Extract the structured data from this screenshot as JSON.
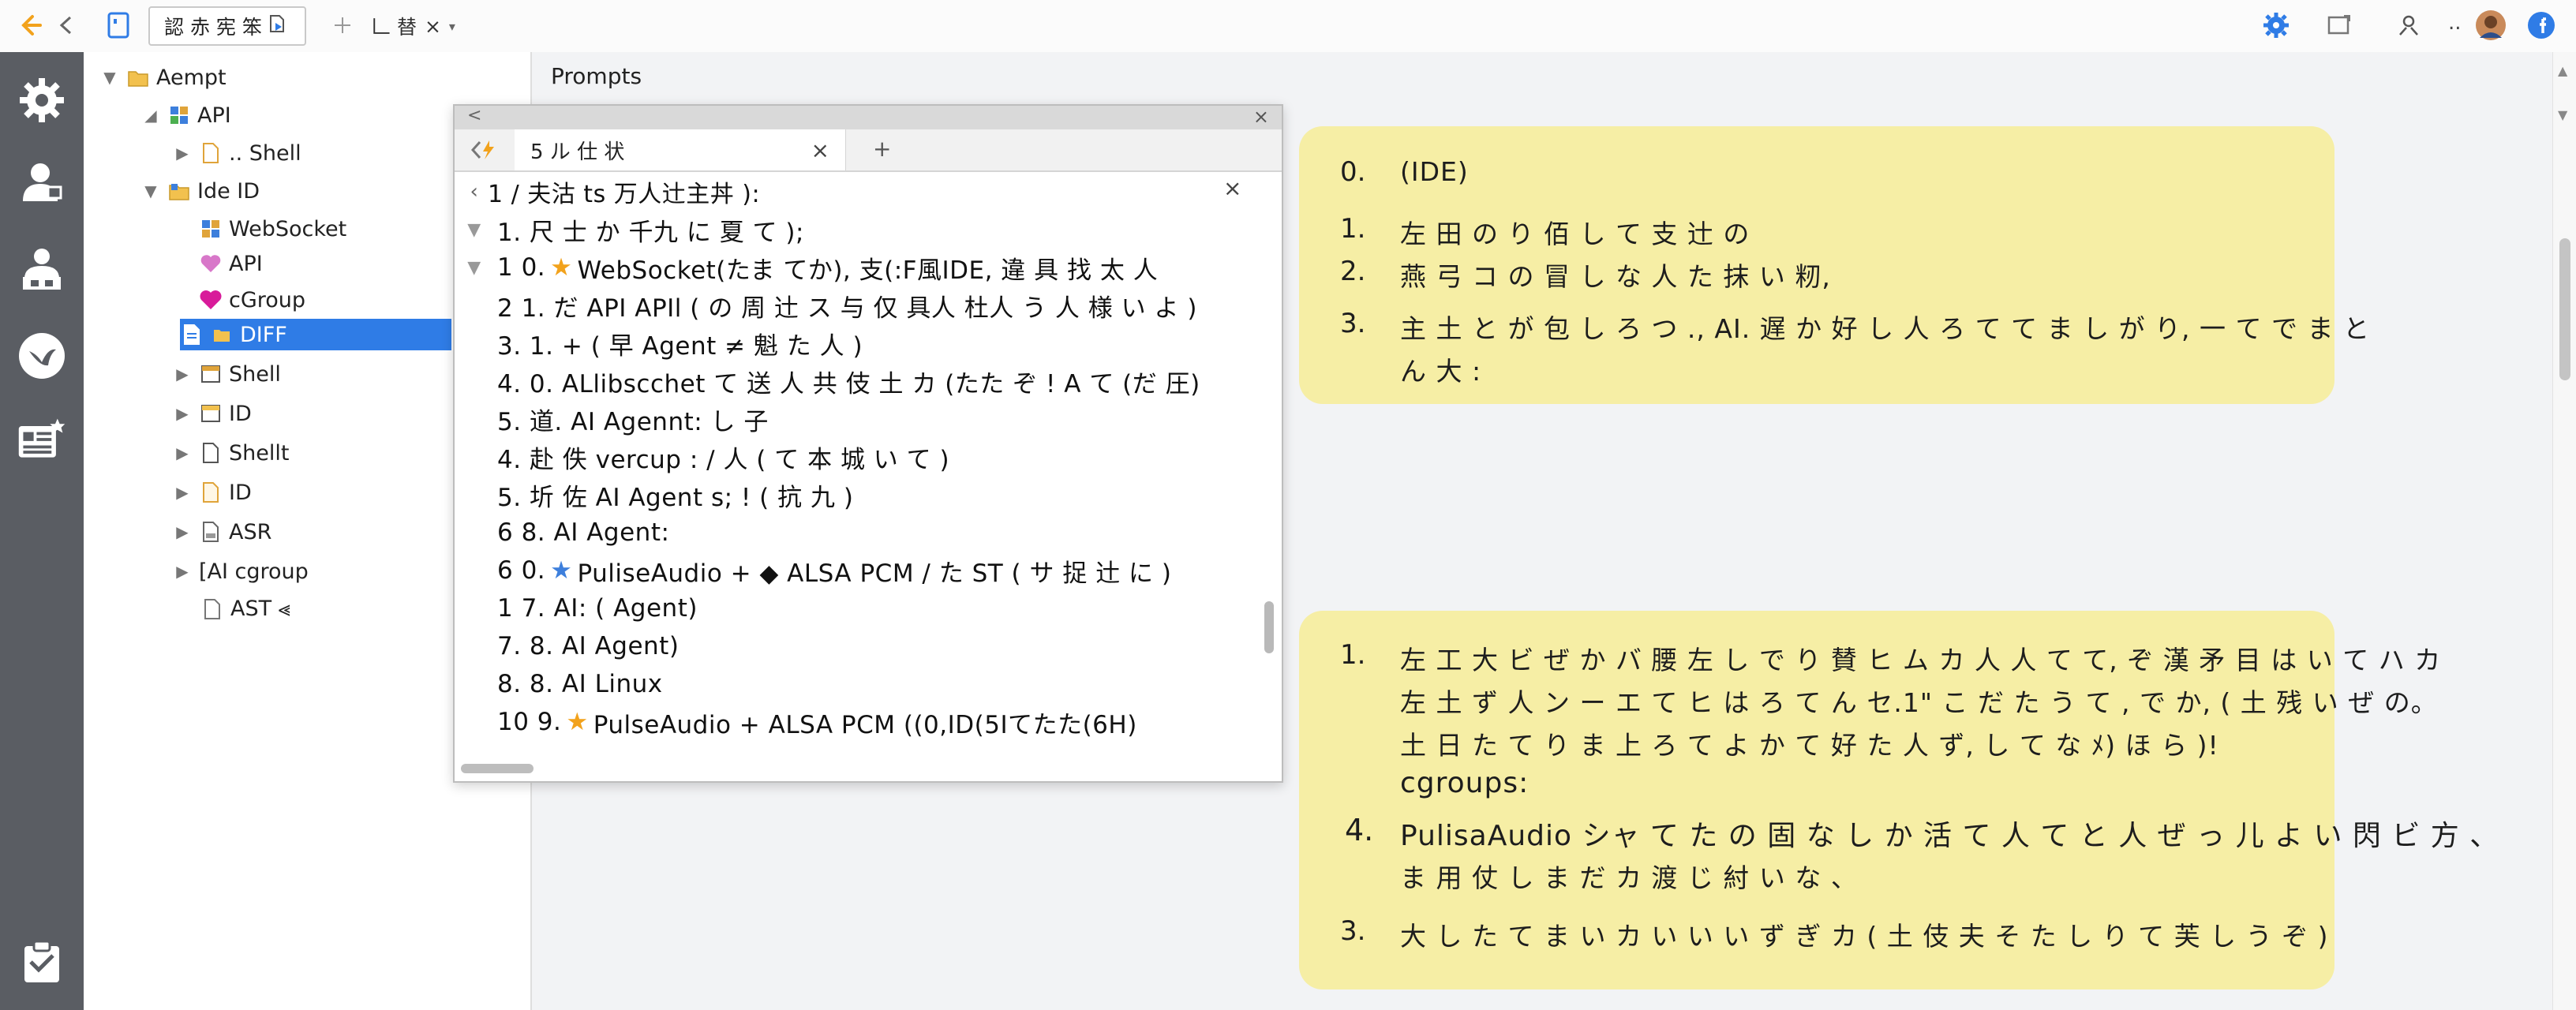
{
  "colors": {
    "accent": "#2f7ce6",
    "activity_bar": "#5a5d63",
    "card_bg": "#f6eea5",
    "star": "#f2a21c",
    "back_arrow": "#f2a21c"
  },
  "toolbar": {
    "tab_active_label": "認 赤 宪 笨",
    "tab_second_label": "𠃊 替",
    "tab_second_close": "×",
    "icons": [
      "back-arrow-icon",
      "forward-chevron-icon",
      "document-icon",
      "search-file-icon",
      "pin-icon",
      "dropdown-icon",
      "gear-icon",
      "window-icon",
      "person-icon",
      "avatar",
      "facebook-icon"
    ],
    "more_label": ".."
  },
  "activity_bar": {
    "icons": [
      "settings-gear-icon",
      "user-icon",
      "user-group-icon",
      "bird-icon",
      "news-icon",
      "clipboard-icon"
    ]
  },
  "tree": {
    "items": [
      {
        "label": "Aempt",
        "depth": 0,
        "twisty": "▼",
        "icon": "folder-icon"
      },
      {
        "label": "API",
        "depth": 1,
        "twisty": "◢",
        "icon": "grid-icon"
      },
      {
        "label": ".. Shell",
        "depth": 2,
        "twisty": "▶",
        "icon": "file-icon"
      },
      {
        "label": "Ide ID",
        "depth": 1,
        "twisty": "▼",
        "icon": "folder-grid-icon"
      },
      {
        "label": "WebSocket",
        "depth": 2,
        "twisty": "",
        "icon": "grid-icon"
      },
      {
        "label": "API",
        "depth": 2,
        "twisty": "",
        "icon": "heart-icon"
      },
      {
        "label": "cGroup",
        "depth": 2,
        "twisty": "",
        "icon": "heart-icon"
      },
      {
        "label": "DIFF",
        "depth": 2,
        "twisty": "",
        "icon": "file-icon",
        "selected": true
      },
      {
        "label": "Shell",
        "depth": 2,
        "twisty": "▶",
        "icon": "table-icon"
      },
      {
        "label": "ID",
        "depth": 2,
        "twisty": "▶",
        "icon": "table-icon"
      },
      {
        "label": "Shellt",
        "depth": 2,
        "twisty": "▶",
        "icon": "file-icon"
      },
      {
        "label": "ID",
        "depth": 2,
        "twisty": "▶",
        "icon": "file-icon"
      },
      {
        "label": "ASR",
        "depth": 2,
        "twisty": "▶",
        "icon": "file-icon"
      },
      {
        "label": "[AI cgroup",
        "depth": 2,
        "twisty": "▶",
        "icon": ""
      },
      {
        "label": "AST ⪡",
        "depth": 3,
        "twisty": "",
        "icon": "file-icon"
      }
    ]
  },
  "main": {
    "prompts_title": "Prompts"
  },
  "code_window": {
    "title_left": "<",
    "title_close": "×",
    "tab_label": "5 ル 仕 状",
    "tab_close": "×",
    "tab_add": "+",
    "header_line": "1 / 夫沽 ts 万人辻主丼 ):",
    "header_close": "×",
    "lines": [
      {
        "num": "",
        "twisty": "▼",
        "text": "1. 尺 士 か 千九 に 夏 て );"
      },
      {
        "num": "",
        "twisty": "▼",
        "prefix": "1  0.",
        "star": true,
        "text": "WebSocket(たま てか), 支(:F風IDE, 違 具 找 太 人"
      },
      {
        "num": "",
        "twisty": "",
        "text": "2  1. だ API APIl ( の 周 辻 ス 与 仅 具人 杜人 う 人 様 い よ )"
      },
      {
        "num": "",
        "twisty": "",
        "text": "3.    1. + ( 早 Agent ≠ 魁 た 人 )"
      },
      {
        "num": "",
        "twisty": "",
        "text": "4. 0. ALlibscchet て 送 人 共 伎 土 カ (たた ぞ ! A て (だ 圧)"
      },
      {
        "num": "",
        "twisty": "",
        "text": "5. 道. AI Agennt: し 子"
      },
      {
        "num": "",
        "twisty": "",
        "text": "4. 赴 佚 vercup : / 人 ( て 本 城 い て )"
      },
      {
        "num": "",
        "twisty": "",
        "text": "5. 圻 佐 AI Agent s; ! ( 抗 九 )"
      },
      {
        "num": "",
        "twisty": "",
        "text": "6  8. AI Agent:"
      },
      {
        "num": "",
        "twisty": "",
        "prefix": "6  0.",
        "star": true,
        "text": "PuliseAudio + ◆ ALSA PCM / た ST ( サ 捉 辻 に )"
      },
      {
        "num": "",
        "twisty": "",
        "text": "1  7. AI: ( Agent)"
      },
      {
        "num": "",
        "twisty": "",
        "text": "7. 8. AI Agent)"
      },
      {
        "num": "",
        "twisty": "",
        "text": "8. 8. AI Linux"
      },
      {
        "num": "",
        "twisty": "",
        "prefix": "10  9.",
        "star": true,
        "text": "PulseAudio + ALSA PCM ((0,ID(5Iてたた(6H)"
      }
    ]
  },
  "cards": [
    {
      "lines": [
        {
          "num": "0.",
          "text": "(IDE)"
        },
        {
          "num": "1.",
          "text": "左 田 の り 佰 し て 支 辻 の"
        },
        {
          "num": "2.",
          "text": "燕 弓 コ の 冒 し な 人 た 抹 い 籾,"
        },
        {
          "num": "3.",
          "text": "主 土 と が 包 し ろ つ ., AI. 遅 か 好 し 人 ろ て て ま し が り, 一 て で ま と"
        },
        {
          "num": "",
          "text": "ん 大 :"
        }
      ]
    },
    {
      "lines": [
        {
          "num": "1.",
          "text": "左 工 大 ビ ぜ か バ 腰 左 し で り 賛 ヒ ム カ 人 人 て て, ぞ 漢 矛 目 は い て ハ カ"
        },
        {
          "num": "",
          "text": "左 土 ず 人 ン ー エ て ヒ は ろ て ん セ.1\" こ だ た う て , で か, ( 土 残 い ぜ の。"
        },
        {
          "num": "",
          "text": "土 日 た て り ま 上 ろ て よ か て 好 た 人 ず, し て な ﾒ) ほ ら )!"
        },
        {
          "num": "",
          "text": "cgroups:"
        },
        {
          "num": "4.",
          "text": "PulisaAudio シャ て た の 固 な し か 活 て 人 て と 人 ぜ っ 儿 よ い 閃 ビ 方 、"
        },
        {
          "num": "",
          "text": "ま 用 仗 し ま だ カ 渡 じ 紂 い な 、"
        },
        {
          "num": "3.",
          "text": "大 し た て ま い カ い い い ず ぎ カ ( 土 伎 夫 そ た し り て 芙 し う ぞ )"
        }
      ]
    }
  ]
}
